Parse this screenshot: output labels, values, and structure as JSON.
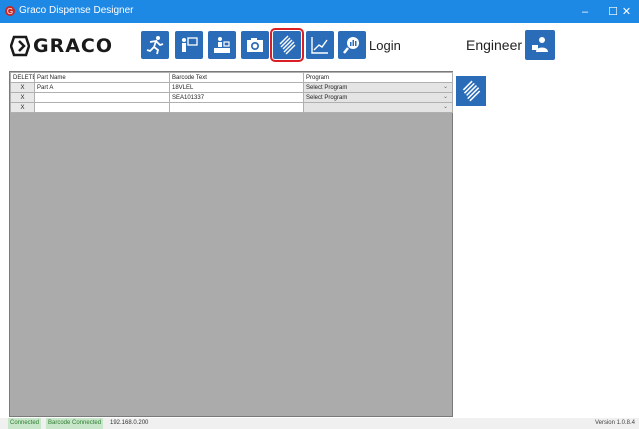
{
  "window": {
    "title": "Graco Dispense Designer",
    "controls": [
      "–",
      "☐",
      "✕"
    ]
  },
  "toolbar": {
    "logo_text": "GRACO",
    "buttons": [
      {
        "icon": "runner-icon"
      },
      {
        "icon": "operator-screen-icon"
      },
      {
        "icon": "dispense-setup-icon"
      },
      {
        "icon": "camera-icon"
      },
      {
        "icon": "barcode-icon",
        "active": true
      },
      {
        "icon": "chart-line-icon"
      },
      {
        "icon": "magnify-chart-icon"
      }
    ],
    "login_label": "Login",
    "user_role": "Engineer"
  },
  "table": {
    "columns": [
      "DELETE",
      "Part Name",
      "Barcode Text",
      "Program"
    ],
    "rows": [
      {
        "delete": "X",
        "part_name": "Part A",
        "barcode": "18VLEL",
        "program": "Select Program"
      },
      {
        "delete": "X",
        "part_name": "",
        "barcode": "SEA101337",
        "program": "Select Program"
      },
      {
        "delete": "X",
        "part_name": "",
        "barcode": "",
        "program": ""
      }
    ]
  },
  "status": {
    "connected": "Connected",
    "barcode": "Barcode Connected",
    "ip": "192.168.0.200",
    "version": "Version 1.0.8.4"
  },
  "colors": {
    "titlebar": "#1e88e5",
    "button": "#2b6cb8",
    "active_outline": "#d81f26",
    "grid_bg": "#ababab"
  }
}
